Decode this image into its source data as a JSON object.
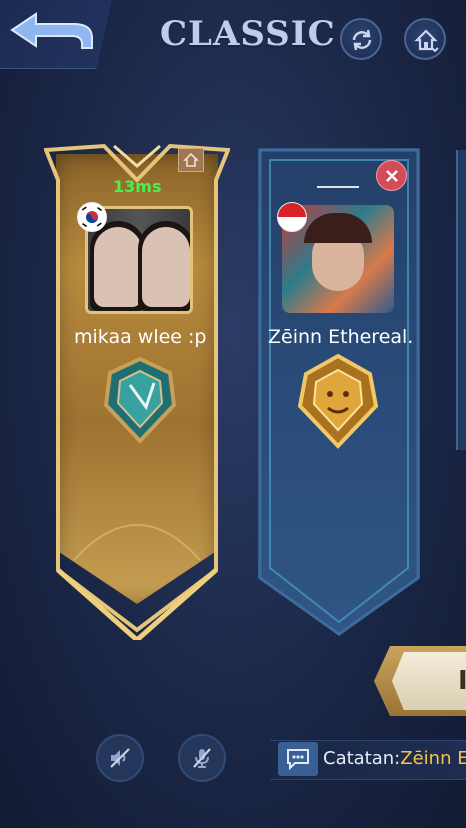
{
  "header": {
    "title": "CLASSIC",
    "back_icon": "back-arrow-icon",
    "refresh_icon": "refresh-icon",
    "home_icon": "home-dropdown-icon"
  },
  "players": [
    {
      "name": "mikaa wlee :p",
      "ping": "13ms",
      "flag": "south-korea-flag-icon",
      "badge_icon": "home-icon",
      "rank_icon": "rank-emblem-icon",
      "card_color": "#b78a3e"
    },
    {
      "name": "Zēinn Ethereal.",
      "ping": "___",
      "flag": "indonesia-flag-icon",
      "badge_icon": "close-icon",
      "rank_icon": "rank-emblem-icon",
      "card_color": "#2b4d7c"
    }
  ],
  "action_button": {
    "label": "I"
  },
  "controls": {
    "speaker_icon": "speaker-muted-icon",
    "mic_icon": "mic-muted-icon"
  },
  "chat": {
    "label": "Catatan:",
    "name": "Zēinn E"
  },
  "colors": {
    "ping_green": "#4cf04a",
    "chat_name_yellow": "#f4c54a",
    "close_red": "#d44d56"
  }
}
